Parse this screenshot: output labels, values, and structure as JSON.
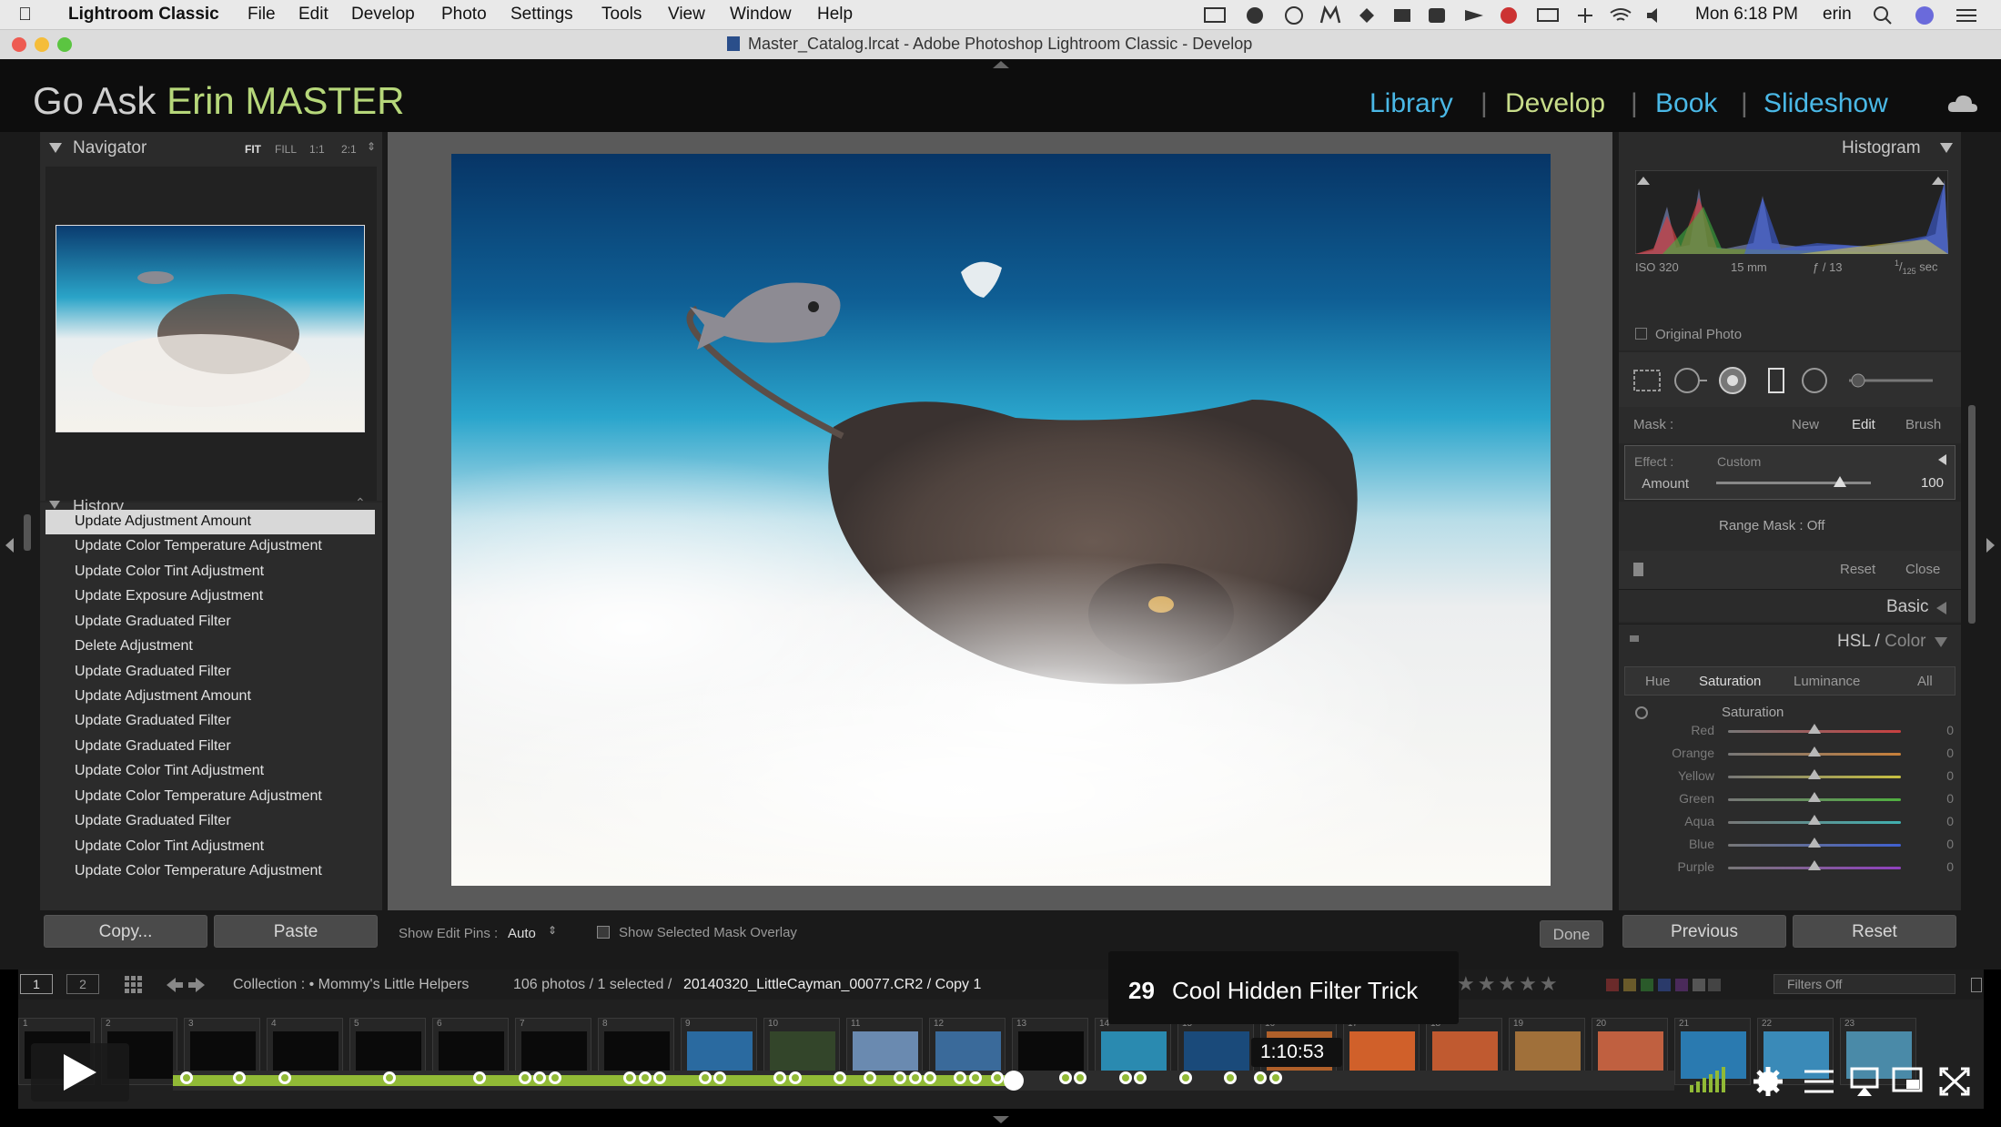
{
  "menubar": {
    "app": "Lightroom Classic",
    "menus": [
      "File",
      "Edit",
      "Develop",
      "Photo",
      "Settings",
      "Tools",
      "View",
      "Window",
      "Help"
    ],
    "clock": "Mon 6:18 PM",
    "user": "erin"
  },
  "window": {
    "title": "Master_Catalog.lrcat - Adobe Photoshop Lightroom Classic - Develop"
  },
  "identity": {
    "prefix": "Go Ask ",
    "name": "Erin MASTER"
  },
  "modules": [
    "Library",
    "Develop",
    "Book",
    "Slideshow"
  ],
  "navigator": {
    "title": "Navigator",
    "zoom": [
      "FIT",
      "FILL",
      "1:1",
      "2:1"
    ]
  },
  "history": {
    "title": "History",
    "items": [
      "Update Adjustment Amount",
      "Update Color Temperature Adjustment",
      "Update Color Tint Adjustment",
      "Update Exposure Adjustment",
      "Update Graduated Filter",
      "Delete Adjustment",
      "Update Graduated Filter",
      "Update Adjustment Amount",
      "Update Graduated Filter",
      "Update Graduated Filter",
      "Update Color Tint Adjustment",
      "Update Color Temperature Adjustment",
      "Update Graduated Filter",
      "Update Color Tint Adjustment",
      "Update Color Temperature Adjustment"
    ],
    "selected_index": 0
  },
  "left_buttons": {
    "copy": "Copy...",
    "paste": "Paste"
  },
  "toolbar": {
    "edit_pins_label": "Show Edit Pins :",
    "edit_pins_value": "Auto",
    "overlay_label": "Show Selected Mask Overlay",
    "done": "Done"
  },
  "histogram": {
    "title": "Histogram",
    "iso": "ISO 320",
    "focal": "15 mm",
    "aperture": "ƒ / 13",
    "shutter_num": "1",
    "shutter_den": "125",
    "shutter_unit": " sec",
    "original_photo": "Original Photo"
  },
  "mask": {
    "label": "Mask :",
    "new": "New",
    "edit": "Edit",
    "brush": "Brush",
    "effect_label": "Effect :",
    "effect_value": "Custom",
    "amount_label": "Amount",
    "amount_value": "100",
    "amount_fraction": 0.8,
    "range_mask": "Range Mask : Off",
    "reset": "Reset",
    "close": "Close"
  },
  "basic": {
    "title": "Basic"
  },
  "hsl": {
    "title_a": "HSL",
    "title_sep": " / ",
    "title_b": "Color",
    "tabs": [
      "Hue",
      "Saturation",
      "Luminance",
      "All"
    ],
    "active_tab": "Saturation",
    "section": "Saturation",
    "sliders": [
      {
        "label": "Red",
        "value": "0",
        "color": "#c84040"
      },
      {
        "label": "Orange",
        "value": "0",
        "color": "#c8803a"
      },
      {
        "label": "Yellow",
        "value": "0",
        "color": "#c8c040"
      },
      {
        "label": "Green",
        "value": "0",
        "color": "#50b040"
      },
      {
        "label": "Aqua",
        "value": "0",
        "color": "#40b0b0"
      },
      {
        "label": "Blue",
        "value": "0",
        "color": "#4060d0"
      },
      {
        "label": "Purple",
        "value": "0",
        "color": "#9040c0"
      }
    ]
  },
  "right_buttons": {
    "previous": "Previous",
    "reset": "Reset"
  },
  "filmbar": {
    "page1": "1",
    "page2": "2",
    "collection": "Collection : • Mommy's Little Helpers",
    "count": "106 photos / 1 selected / ",
    "filename": "20140320_LittleCayman_00077.CR2 / Copy 1",
    "filters": "Filters Off"
  },
  "thumb_numbers": [
    "1",
    "2",
    "3",
    "4",
    "5",
    "6",
    "7",
    "8",
    "9",
    "10",
    "11",
    "12",
    "13",
    "14",
    "15",
    "16",
    "17",
    "18",
    "19",
    "20",
    "21",
    "22",
    "23"
  ],
  "video": {
    "chapter_number": "29",
    "chapter_title": "Cool Hidden Filter Trick",
    "timecode": "1:10:53",
    "progress": 0.56
  },
  "colors": {
    "accent_green": "#91ba36",
    "module_blue": "#4ab8e6",
    "identity_green": "#b6d77a"
  }
}
